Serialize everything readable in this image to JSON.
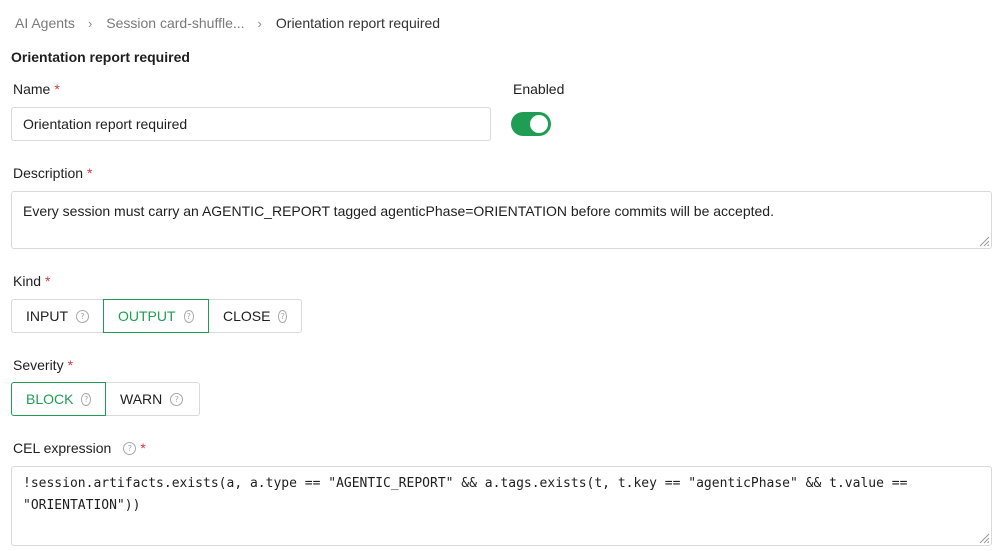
{
  "breadcrumb": {
    "items": [
      "AI Agents",
      "Session card-shuffle...",
      "Orientation report required"
    ],
    "separator": "›"
  },
  "page": {
    "title": "Orientation report required"
  },
  "form": {
    "required_marker": "*",
    "name": {
      "label": "Name",
      "value": "Orientation report required"
    },
    "enabled": {
      "label": "Enabled",
      "on": true
    },
    "description": {
      "label": "Description",
      "value": "Every session must carry an AGENTIC_REPORT tagged agenticPhase=ORIENTATION before commits will be accepted."
    },
    "kind": {
      "label": "Kind",
      "options": [
        "INPUT",
        "OUTPUT",
        "CLOSE"
      ],
      "selected": "OUTPUT"
    },
    "severity": {
      "label": "Severity",
      "options": [
        "BLOCK",
        "WARN"
      ],
      "selected": "BLOCK"
    },
    "cel": {
      "label": "CEL expression",
      "line1": "!session.artifacts.exists(a, a.type == \"AGENTIC_REPORT\" && a.tags.exists(t, t.key == \"agenticPhase\" && t.value ==",
      "line2": "\"ORIENTATION\"))"
    }
  },
  "icons": {
    "help": "question-circle-icon",
    "resize": "resize-handle-icon"
  },
  "colors": {
    "accent": "#1f9d55",
    "required": "#d9363e",
    "border": "#d9d9d9",
    "muted_text": "#7a7a7a"
  }
}
